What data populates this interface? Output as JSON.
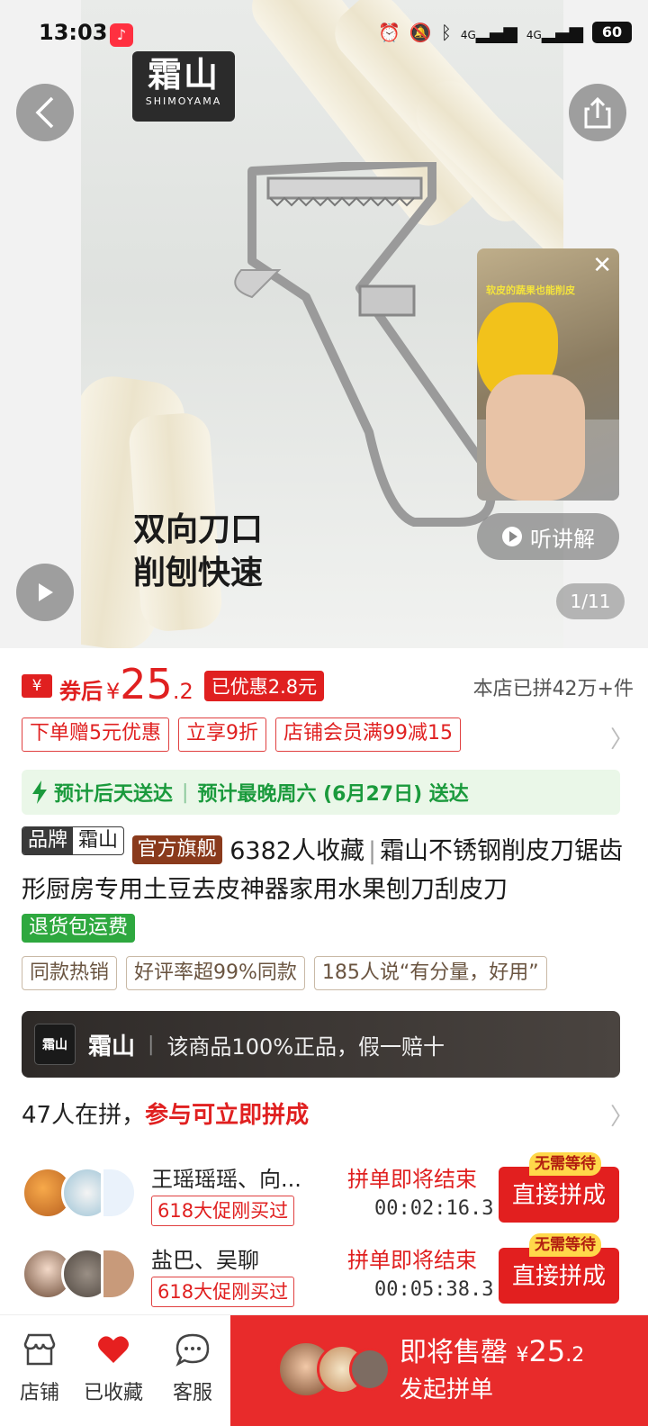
{
  "status_bar": {
    "time": "13:03",
    "net1": "4G",
    "net2": "4G",
    "battery": "60"
  },
  "hero": {
    "brand_logo_main": "霜山",
    "brand_logo_sub": "SHIMOYAMA",
    "caption_line1": "双向刀口",
    "caption_line2": "削刨快速",
    "mini_video_caption": "软皮的蔬果也能削皮",
    "explain_label": "听讲解",
    "page_indicator": "1/11"
  },
  "price": {
    "coupon_icon": "¥",
    "after_coupon_label": "券后",
    "currency": "¥",
    "price_integer": "25",
    "price_decimal": ".2",
    "saved_badge": "已优惠2.8元",
    "sold_count": "本店已拼42万+件"
  },
  "promos": [
    {
      "label": "下单赠5元优惠"
    },
    {
      "label": "立享9折"
    },
    {
      "label": "店铺会员满99减15"
    }
  ],
  "delivery": {
    "primary": "预计后天送达",
    "secondary": "预计最晚周六 (6月27日) 送达"
  },
  "product": {
    "brand_key": "品牌",
    "brand_value": "霜山",
    "official_tag": "官方旗舰",
    "favorites": "6382人收藏",
    "title": "霜山不锈钢削皮刀锯齿形厨房专用土豆去皮神器家用水果刨刀刮皮刀",
    "return_tag": "退货包运费"
  },
  "chips": [
    {
      "label": "同款热销"
    },
    {
      "label": "好评率超99%同款"
    },
    {
      "label": "185人说“有分量，好用”"
    }
  ],
  "brand_banner": {
    "logo_text": "霜山",
    "name": "霜山",
    "guarantee": "该商品100%正品，假一赔十"
  },
  "group_buy": {
    "count_text": "47人在拼，",
    "highlight": "参与可立即拼成",
    "items": [
      {
        "names": "王瑶瑶瑶、向...",
        "badge": "618大促刚买过",
        "ending": "拼单即将结束",
        "timer": "00:02:16.3",
        "button": "直接拼成",
        "no_wait": "无需等待"
      },
      {
        "names": "盐巴、吴聊",
        "badge": "618大促刚买过",
        "ending": "拼单即将结束",
        "timer": "00:05:38.3",
        "button": "直接拼成",
        "no_wait": "无需等待"
      }
    ]
  },
  "bottom_bar": {
    "tabs": [
      {
        "label": "店铺",
        "icon": "shop-icon"
      },
      {
        "label": "已收藏",
        "icon": "heart-icon"
      },
      {
        "label": "客服",
        "icon": "chat-icon"
      }
    ],
    "buy_label": "即将售罄",
    "buy_currency": "¥",
    "buy_price_int": "25",
    "buy_price_dec": ".2",
    "buy_sub": "发起拼单"
  },
  "colors": {
    "accent_red": "#e02020",
    "delivery_green": "#1a9a3c",
    "banner_dark": "#2e2a28"
  }
}
